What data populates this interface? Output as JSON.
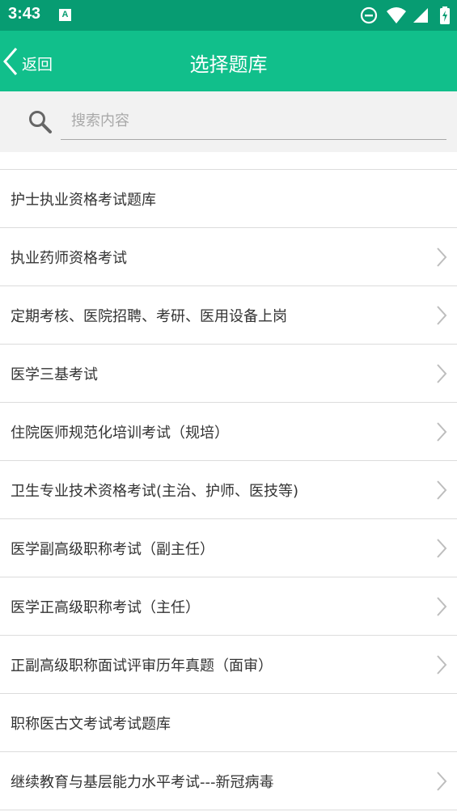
{
  "status_bar": {
    "time": "3:43",
    "notification_letter": "A"
  },
  "header": {
    "back_label": "返回",
    "title": "选择题库"
  },
  "search": {
    "placeholder": "搜索内容"
  },
  "list": {
    "items": [
      {
        "label": "护士执业资格考试题库",
        "has_chevron": false
      },
      {
        "label": "执业药师资格考试",
        "has_chevron": true
      },
      {
        "label": "定期考核、医院招聘、考研、医用设备上岗",
        "has_chevron": true
      },
      {
        "label": "医学三基考试",
        "has_chevron": true
      },
      {
        "label": "住院医师规范化培训考试（规培）",
        "has_chevron": true
      },
      {
        "label": "卫生专业技术资格考试(主治、护师、医技等)",
        "has_chevron": true
      },
      {
        "label": "医学副高级职称考试（副主任）",
        "has_chevron": true
      },
      {
        "label": "医学正高级职称考试（主任）",
        "has_chevron": true
      },
      {
        "label": "正副高级职称面试评审历年真题（面审）",
        "has_chevron": true
      },
      {
        "label": "职称医古文考试考试题库",
        "has_chevron": false
      },
      {
        "label": "继续教育与基层能力水平考试---新冠病毒",
        "has_chevron": true
      }
    ]
  },
  "colors": {
    "status_bar": "#079c72",
    "app_bar": "#11bf8b",
    "search_bg": "#f2f2f2",
    "divider": "#dcdcdc",
    "text": "#333333",
    "chevron": "#bdbdbd"
  }
}
